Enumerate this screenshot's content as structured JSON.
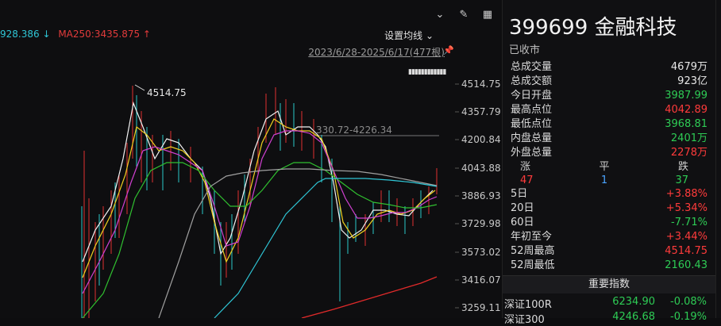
{
  "chart": {
    "ma_cyan": "928.386 ↓",
    "ma250": "MA250:3435.875 ↑",
    "settings_label": "设置均线",
    "date_range": "2023/6/28-2025/6/17(477根)",
    "peak_label": "4514.75",
    "range_label": "330.72-4226.34",
    "y_ticks": [
      "4514.75",
      "4357.79",
      "4200.84",
      "4043.88",
      "3886.93",
      "3729.98",
      "3573.02",
      "3416.07",
      "3259.11"
    ]
  },
  "header": {
    "title": "399699 金融科技",
    "status": "已收市"
  },
  "stats": [
    {
      "label": "总成交量",
      "value": "4679万",
      "color": "w"
    },
    {
      "label": "总成交额",
      "value": "923亿",
      "color": "w"
    },
    {
      "label": "今日开盘",
      "value": "3987.99",
      "color": "g"
    },
    {
      "label": "最高点位",
      "value": "4042.89",
      "color": "r"
    },
    {
      "label": "最低点位",
      "value": "3968.81",
      "color": "g"
    },
    {
      "label": "内盘总量",
      "value": "2401万",
      "color": "g"
    },
    {
      "label": "外盘总量",
      "value": "2278万",
      "color": "r"
    }
  ],
  "advance": {
    "up_label": "涨",
    "flat_label": "平",
    "down_label": "跌",
    "up": "47",
    "flat": "1",
    "down": "37"
  },
  "performance": [
    {
      "label": "5日",
      "value": "+3.88%",
      "color": "r"
    },
    {
      "label": "20日",
      "value": "+5.34%",
      "color": "r"
    },
    {
      "label": "60日",
      "value": "-7.71%",
      "color": "g"
    },
    {
      "label": "年初至今",
      "value": "+3.44%",
      "color": "r"
    },
    {
      "label": "52周最高",
      "value": "4514.75",
      "color": "r"
    },
    {
      "label": "52周最低",
      "value": "2160.43",
      "color": "g"
    }
  ],
  "indices_header": "重要指数",
  "indices": [
    {
      "name": "深证100R",
      "value": "6234.90",
      "pct": "-0.08%"
    },
    {
      "name": "深证300",
      "value": "4246.68",
      "pct": "-0.19%"
    }
  ]
}
